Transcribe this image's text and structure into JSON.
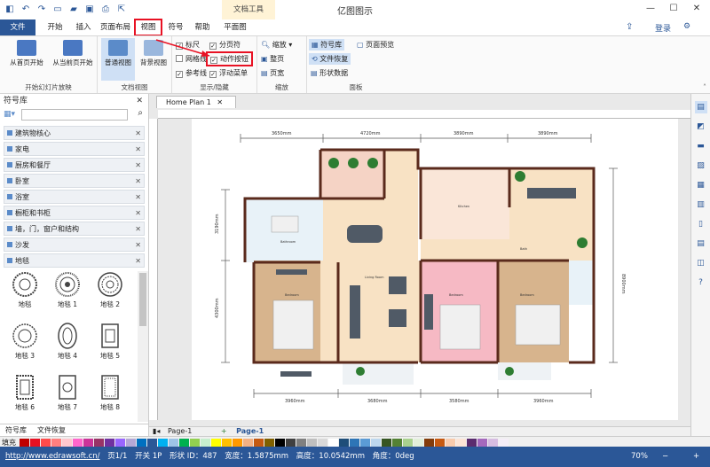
{
  "window": {
    "title": "亿图图示",
    "context_group": "文档工具",
    "login": "登录"
  },
  "tabs": [
    "文件",
    "开始",
    "插入",
    "页面布局",
    "视图",
    "符号",
    "帮助",
    "平面图"
  ],
  "ribbon": {
    "groups": [
      {
        "label": "开始幻灯片放映",
        "buttons": [
          "从首页开始",
          "从当前页开始"
        ]
      },
      {
        "label": "文档视图",
        "buttons": [
          "普通视图",
          "背景视图"
        ]
      },
      {
        "label": "显示/隐藏",
        "items": [
          "标尺",
          "分页符",
          "网格线",
          "动作按钮",
          "参考线",
          "浮动菜单"
        ]
      },
      {
        "label": "缩放",
        "items": [
          "缩放",
          "整页",
          "页宽"
        ]
      },
      {
        "label": "面板",
        "items": [
          "符号库",
          "页面预览",
          "文件恢复",
          "形状数据"
        ]
      }
    ]
  },
  "library": {
    "title": "符号库",
    "search_placeholder": "",
    "categories": [
      "建筑物核心",
      "家电",
      "厨房和餐厅",
      "卧室",
      "浴室",
      "橱柜和书柜",
      "墙，门，窗户和结构",
      "沙发",
      "地毯"
    ],
    "shapes": [
      "地毯",
      "地毯 1",
      "地毯 2",
      "地毯 3",
      "地毯 4",
      "地毯 5",
      "地毯 6",
      "地毯 7",
      "地毯 8"
    ],
    "bottom_tabs": [
      "符号库",
      "文件恢复"
    ]
  },
  "document": {
    "tab": "Home Plan 1",
    "dims_top": [
      "3650mm",
      "4720mm",
      "3890mm",
      "3890mm"
    ],
    "dims_bottom": [
      "3960mm",
      "3680mm",
      "3580mm",
      "3960mm"
    ],
    "dims_left": [
      "3190mm",
      "4300mm"
    ],
    "dims_right": [
      "8900mm"
    ],
    "room_labels": [
      "Kitchen",
      "Bathroom",
      "Living Room",
      "Bedroom",
      "Bedroom",
      "Bedroom",
      "Bath"
    ]
  },
  "pages": {
    "current": "Page-1",
    "tab": "Page-1"
  },
  "colorbar_label": "填充",
  "status": {
    "url": "http://www.edrawsoft.cn/",
    "page": "页1/1",
    "shapes_info": "开关 1P",
    "shape_id": "形状 ID：487",
    "width": "宽度：1.5875mm",
    "height": "高度：10.0542mm",
    "angle": "角度：0deg",
    "zoom": "70%"
  },
  "colors": {
    "brand": "#2b5797",
    "highlight": "#e81123"
  },
  "palette": [
    "#c00000",
    "#e81123",
    "#ff4b4b",
    "#ff7f7f",
    "#ffc7ce",
    "#ff66cc",
    "#cc3399",
    "#993366",
    "#7030a0",
    "#9966ff",
    "#b4a7d6",
    "#0070c0",
    "#2b5797",
    "#00b0f0",
    "#9dc3e6",
    "#00b050",
    "#92d050",
    "#c6efce",
    "#ffff00",
    "#ffc000",
    "#ff9900",
    "#f4b183",
    "#c55a11",
    "#7f6000",
    "#000000",
    "#404040",
    "#808080",
    "#bfbfbf",
    "#d9d9d9",
    "#ffffff",
    "#1f4e79",
    "#2e75b6",
    "#5b9bd5",
    "#bdd7ee",
    "#375623",
    "#548235",
    "#a9d18e",
    "#e2efda",
    "#833c0b",
    "#c65911",
    "#f8cbad",
    "#fce4d6",
    "#5b2c6f",
    "#a569bd",
    "#d7bde2",
    "#f5eef8"
  ]
}
